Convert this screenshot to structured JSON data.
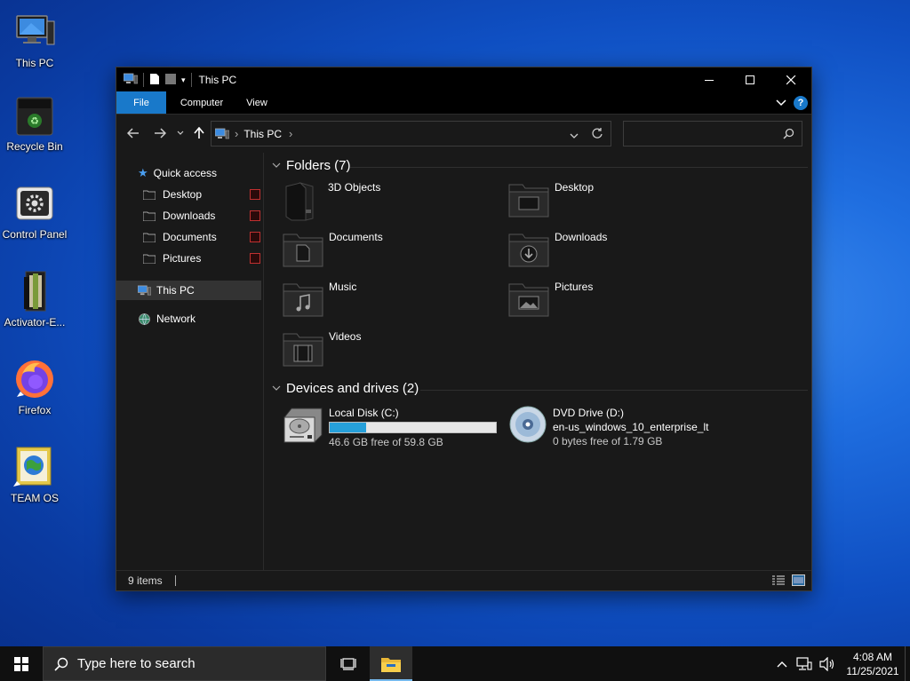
{
  "desktop": {
    "icons": [
      {
        "label": "This PC",
        "icon": "this-pc-icon"
      },
      {
        "label": "Recycle Bin",
        "icon": "recycle-bin-icon"
      },
      {
        "label": "Control Panel",
        "icon": "control-panel-icon"
      },
      {
        "label": "Activator-E...",
        "icon": "activator-folder-icon"
      },
      {
        "label": "Firefox",
        "icon": "firefox-icon"
      },
      {
        "label": "TEAM OS",
        "icon": "team-os-icon"
      }
    ]
  },
  "window": {
    "title": "This PC",
    "controls": {
      "minimize": "—",
      "maximize": "☐",
      "close": "✕"
    },
    "ribbon_tabs": [
      "File",
      "Computer",
      "View"
    ],
    "help": "?",
    "address": {
      "crumb": "This PC",
      "separator": "›"
    },
    "search": {
      "placeholder": ""
    },
    "nav": {
      "quick_access": "Quick access",
      "quick_items": [
        "Desktop",
        "Downloads",
        "Documents",
        "Pictures"
      ],
      "this_pc": "This PC",
      "network": "Network"
    },
    "folders_header": "Folders (7)",
    "folders": [
      {
        "name": "3D Objects",
        "icon": "3d-objects-icon"
      },
      {
        "name": "Desktop",
        "icon": "desktop-folder-icon"
      },
      {
        "name": "Documents",
        "icon": "documents-folder-icon"
      },
      {
        "name": "Downloads",
        "icon": "downloads-folder-icon"
      },
      {
        "name": "Music",
        "icon": "music-folder-icon"
      },
      {
        "name": "Pictures",
        "icon": "pictures-folder-icon"
      },
      {
        "name": "Videos",
        "icon": "videos-folder-icon"
      }
    ],
    "drives_header": "Devices and drives (2)",
    "drives": [
      {
        "name": "Local Disk (C:)",
        "sub": "",
        "free": "46.6 GB free of 59.8 GB",
        "used_fraction": 0.221,
        "icon": "hard-disk-icon"
      },
      {
        "name": "DVD Drive (D:)",
        "sub": "en-us_windows_10_enterprise_lt",
        "free": "0 bytes free of 1.79 GB",
        "icon": "dvd-drive-icon"
      }
    ],
    "status": "9 items",
    "accent": "#1979ca",
    "bar_color": "#26a0da"
  },
  "taskbar": {
    "search_placeholder": "Type here to search",
    "time": "4:08 AM",
    "date": "11/25/2021"
  }
}
